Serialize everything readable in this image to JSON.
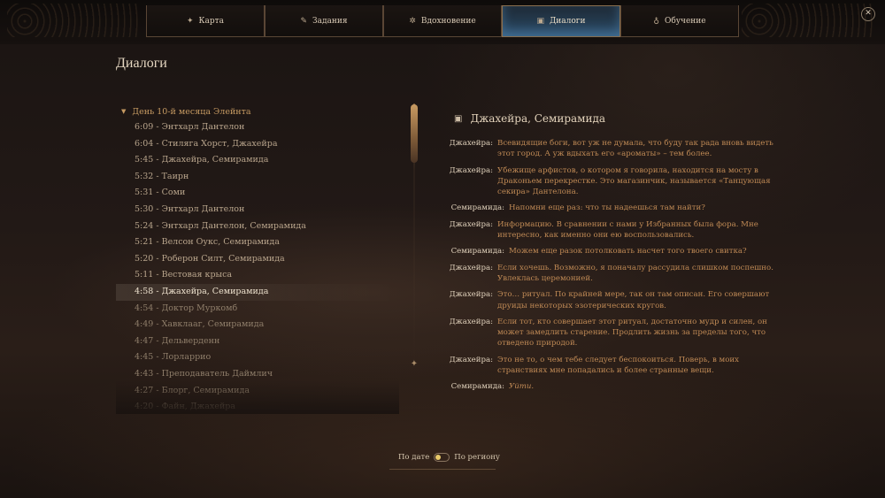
{
  "nav": {
    "tabs": [
      {
        "label": "Карта",
        "icon": "✦"
      },
      {
        "label": "Задания",
        "icon": "✎"
      },
      {
        "label": "Вдохновение",
        "icon": "✲"
      },
      {
        "label": "Диалоги",
        "icon": "▣"
      },
      {
        "label": "Обучение",
        "icon": "♁"
      }
    ],
    "close_label": "✕"
  },
  "page": {
    "title": "Диалоги"
  },
  "journal": {
    "group_label": "День 10-й месяца Элейнта",
    "entries": [
      "6:09 - Энтхарл Дантелон",
      "6:04 - Стилягa Хорст, Джахейра",
      "5:45 - Джахейра, Семирамида",
      "5:32 - Таирн",
      "5:31 - Соми",
      "5:30 - Энтхарл Дантелон",
      "5:24 - Энтхарл Дантелон, Семирамида",
      "5:21 - Велсон Оукс, Семирамида",
      "5:20 - Роберон Силт, Семирамида",
      "5:11 - Вестовая крыса",
      "4:58 - Джахейра, Семирамида",
      "4:54 - Доктор Муркомб",
      "4:49 - Хавклааг, Семирамида",
      "4:47 - Дельверденн",
      "4:45 - Лорларрио",
      "4:43 - Преподаватель Даймлич",
      "4:27 - Блорг, Семирамида",
      "4:20 - Файн, Джахейра"
    ],
    "selected_index": 10
  },
  "dialogue": {
    "title": "Джахейра, Семирамида",
    "lines": [
      {
        "speaker": "Джахейра:",
        "text": "Всевидящие боги, вот уж не думала, что буду так рада вновь видеть этот город. А уж вдыхать его «ароматы» – тем более."
      },
      {
        "speaker": "Джахейра:",
        "text": "Убежище арфистов, о котором я говорила, находится на мосту в Драконьем перекрестке. Это магазинчик, называется «Танцующая секира» Дантелона."
      },
      {
        "speaker": "Семирамида:",
        "text": "Напомни еще раз: что ты надеешься там найти?"
      },
      {
        "speaker": "Джахейра:",
        "text": "Информацию. В сравнении с нами у Избранных была фора. Мне интересно, как именно они ею воспользовались."
      },
      {
        "speaker": "Семирамида:",
        "text": "Можем еще разок потолковать насчет того твоего свитка?"
      },
      {
        "speaker": "Джахейра:",
        "text": "Если хочешь. Возможно, я поначалу рассудила слишком поспешно. Увлеклась церемонией."
      },
      {
        "speaker": "Джахейра:",
        "text": "Это… ритуал. По крайней мере, так он там описан. Его совершают друиды некоторых эзотерических кругов."
      },
      {
        "speaker": "Джахейра:",
        "text": "Если тот, кто совершает этот ритуал, достаточно мудр и силен, он может замедлить старение. Продлить жизнь за пределы того, что отведено природой."
      },
      {
        "speaker": "Джахейра:",
        "text": "Это не то, о чем тебе следует беспокоиться. Поверь, в моих странствиях мне попадались и более странные вещи."
      },
      {
        "speaker": "Семирамида:",
        "text": "Уйти."
      }
    ]
  },
  "sort": {
    "by_date": "По дате",
    "by_region": "По региону"
  },
  "colors": {
    "accent": "#c69a62",
    "dialogue_text": "#c08a55",
    "active_tab": "#2a4a66"
  }
}
